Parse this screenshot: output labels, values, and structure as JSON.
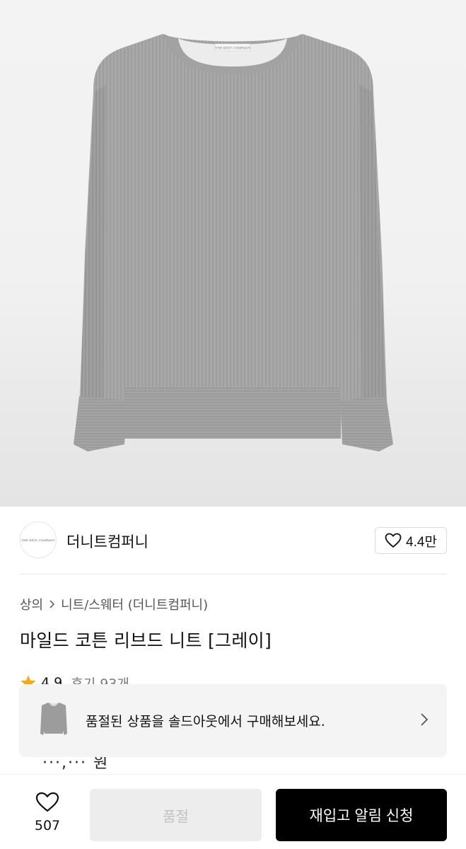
{
  "product_image": {
    "alt": "gray ribbed knit sweater",
    "tag_text": "THE KNIT COMPANY"
  },
  "brand": {
    "name": "더니트컴퍼니",
    "logo_text": "THE KNIT COMPANY",
    "like_count": "4.4만"
  },
  "breadcrumb": {
    "category": "상의",
    "subcategory": "니트/스웨터 (더니트컴퍼니)"
  },
  "product": {
    "title": "마일드 코튼 리브드 니트 [그레이]"
  },
  "rating": {
    "score": "4.9",
    "reviews": "후기 93개"
  },
  "price_peek": "···,··· 원",
  "banner": {
    "text": "품절된 상품을 솔드아웃에서 구매해보세요."
  },
  "bottom": {
    "wish_count": "507",
    "soldout_label": "품절",
    "restock_label": "재입고 알림 신청"
  },
  "colors": {
    "accent": "#000000",
    "star": "#f5a623",
    "sweater": "#a9a9a9"
  }
}
